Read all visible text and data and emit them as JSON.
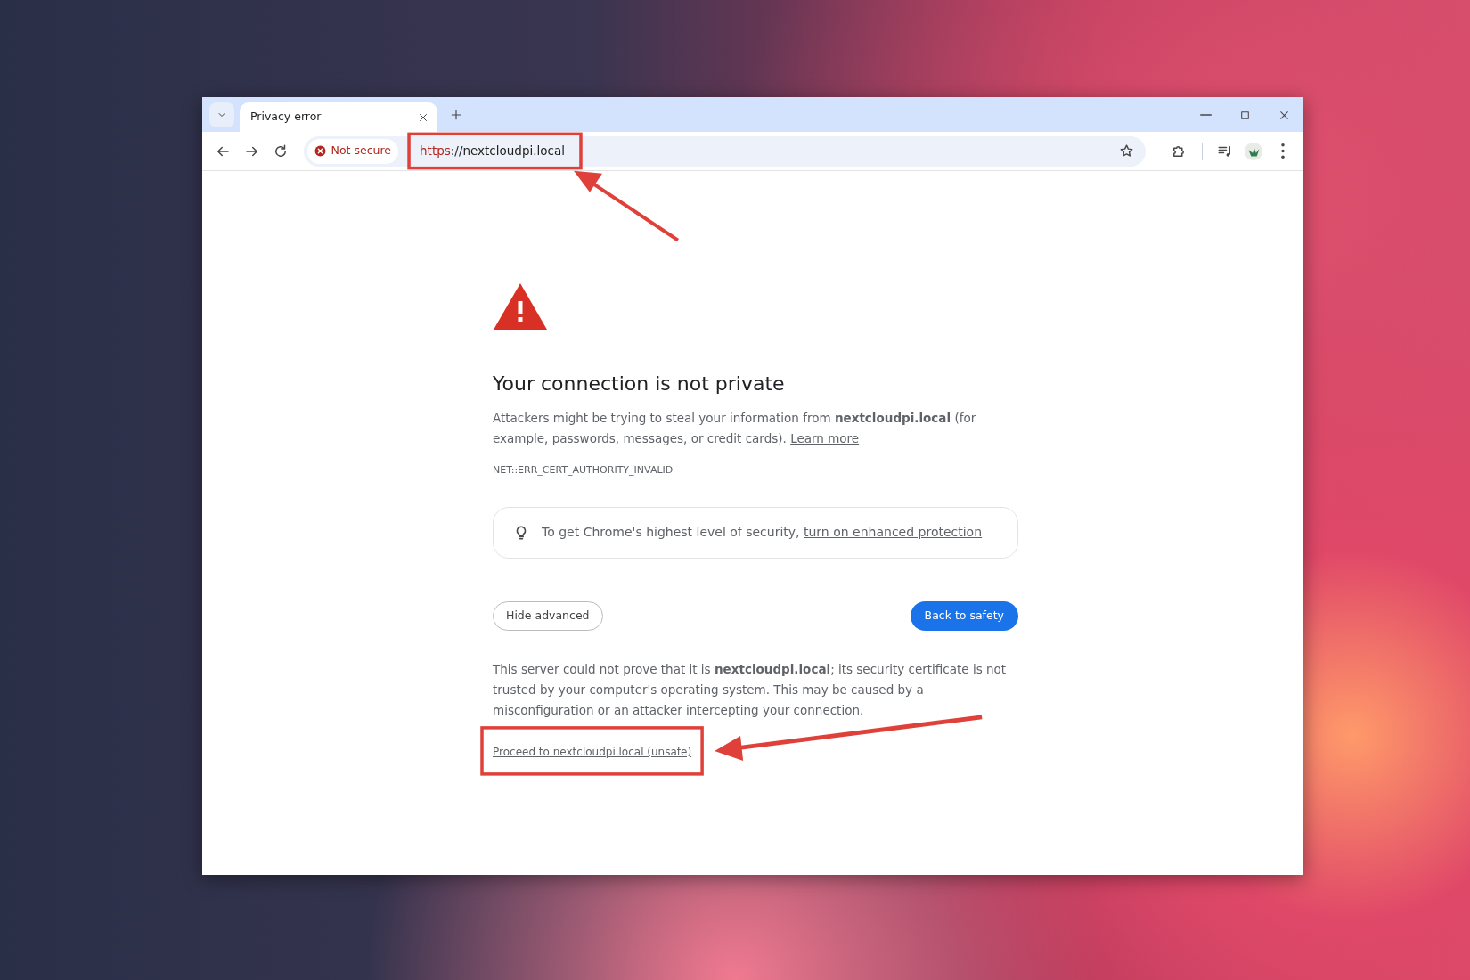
{
  "tabs": [
    {
      "title": "Privacy error",
      "selected": true
    }
  ],
  "address_bar": {
    "security_label": "Not secure",
    "url_scheme": "https",
    "url_rest": "://nextcloudpi.local"
  },
  "page": {
    "heading": "Your connection is not private",
    "description": "Attackers might be trying to steal your information from **nextcloudpi.local** (for example, passwords, messages, or credit cards).",
    "learn_more": "Learn more",
    "error_code": "NET::ERR_CERT_AUTHORITY_INVALID",
    "hint": {
      "text": "To get Chrome's highest level of security,",
      "link": "turn on enhanced protection"
    },
    "secondary_button": "Hide advanced",
    "primary_button": "Back to safety",
    "details": "This server could not prove that it is **nextcloudpi.local**; its security certificate is not trusted by your computer's operating system. This may be caused by a misconfiguration or an attacker intercepting your connection.",
    "proceed_link": "Proceed to nextcloudpi.local (unsafe)"
  }
}
